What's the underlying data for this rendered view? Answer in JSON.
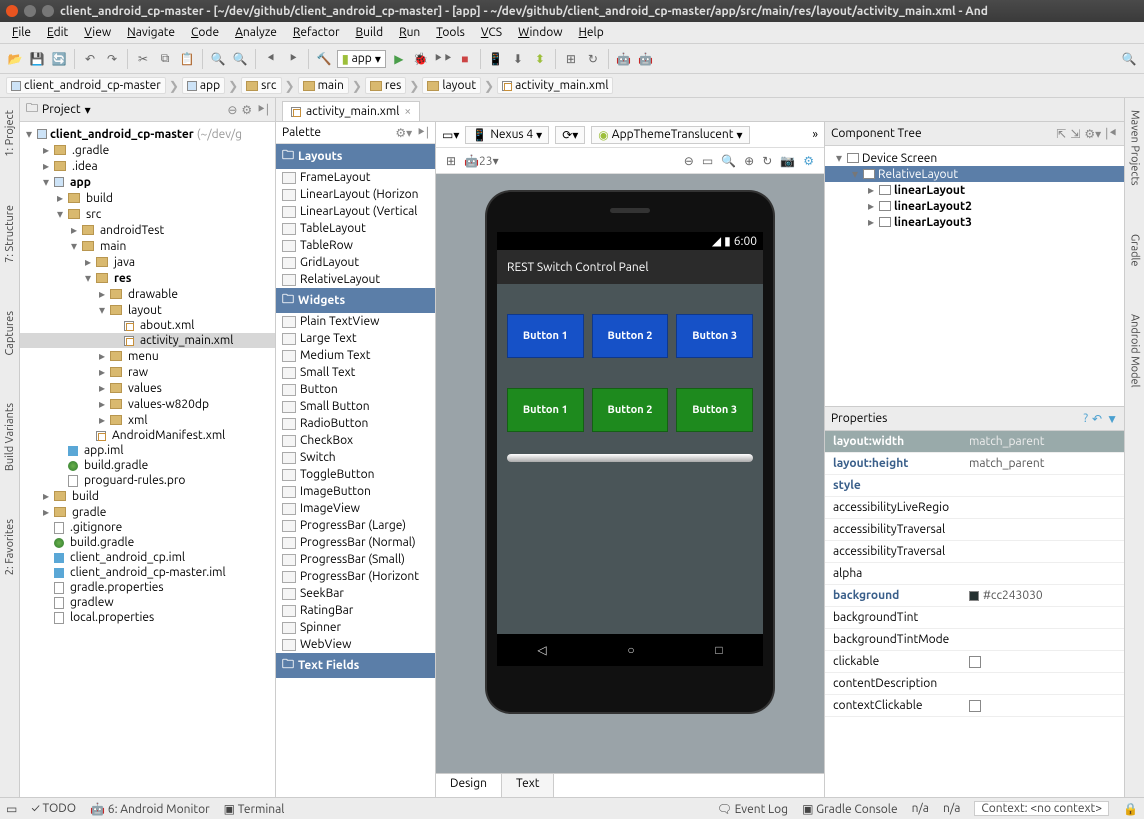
{
  "title": "client_android_cp-master - [~/dev/github/client_android_cp-master] - [app] - ~/dev/github/client_android_cp-master/app/src/main/res/layout/activity_main.xml - And",
  "menu": [
    "File",
    "Edit",
    "View",
    "Navigate",
    "Code",
    "Analyze",
    "Refactor",
    "Build",
    "Run",
    "Tools",
    "VCS",
    "Window",
    "Help"
  ],
  "toolbar_app": "app",
  "breadcrumb": [
    "client_android_cp-master",
    "app",
    "src",
    "main",
    "res",
    "layout",
    "activity_main.xml"
  ],
  "project_panel_label": "Project",
  "tree": {
    "root": "client_android_cp-master",
    "root_suffix": "(~/dev/g",
    "nodes": [
      {
        "d": 1,
        "exp": "▸",
        "icon": "dir",
        "t": ".gradle"
      },
      {
        "d": 1,
        "exp": "▸",
        "icon": "dir",
        "t": ".idea"
      },
      {
        "d": 1,
        "exp": "▾",
        "icon": "mod",
        "t": "app",
        "b": true
      },
      {
        "d": 2,
        "exp": "▸",
        "icon": "dir",
        "t": "build"
      },
      {
        "d": 2,
        "exp": "▾",
        "icon": "dir",
        "t": "src"
      },
      {
        "d": 3,
        "exp": "▸",
        "icon": "dir",
        "t": "androidTest"
      },
      {
        "d": 3,
        "exp": "▾",
        "icon": "dir",
        "t": "main"
      },
      {
        "d": 4,
        "exp": "▸",
        "icon": "dir",
        "t": "java"
      },
      {
        "d": 4,
        "exp": "▾",
        "icon": "dir",
        "t": "res",
        "b": true
      },
      {
        "d": 5,
        "exp": "▸",
        "icon": "dir",
        "t": "drawable"
      },
      {
        "d": 5,
        "exp": "▾",
        "icon": "dir",
        "t": "layout"
      },
      {
        "d": 6,
        "exp": "",
        "icon": "xml",
        "t": "about.xml"
      },
      {
        "d": 6,
        "exp": "",
        "icon": "xml",
        "t": "activity_main.xml",
        "sel": true
      },
      {
        "d": 5,
        "exp": "▸",
        "icon": "dir",
        "t": "menu"
      },
      {
        "d": 5,
        "exp": "▸",
        "icon": "dir",
        "t": "raw"
      },
      {
        "d": 5,
        "exp": "▸",
        "icon": "dir",
        "t": "values"
      },
      {
        "d": 5,
        "exp": "▸",
        "icon": "dir",
        "t": "values-w820dp"
      },
      {
        "d": 5,
        "exp": "▸",
        "icon": "dir",
        "t": "xml"
      },
      {
        "d": 4,
        "exp": "",
        "icon": "xml",
        "t": "AndroidManifest.xml"
      },
      {
        "d": 2,
        "exp": "",
        "icon": "iml",
        "t": "app.iml"
      },
      {
        "d": 2,
        "exp": "",
        "icon": "grad",
        "t": "build.gradle"
      },
      {
        "d": 2,
        "exp": "",
        "icon": "file",
        "t": "proguard-rules.pro"
      },
      {
        "d": 1,
        "exp": "▸",
        "icon": "dir",
        "t": "build"
      },
      {
        "d": 1,
        "exp": "▸",
        "icon": "dir",
        "t": "gradle"
      },
      {
        "d": 1,
        "exp": "",
        "icon": "file",
        "t": ".gitignore"
      },
      {
        "d": 1,
        "exp": "",
        "icon": "grad",
        "t": "build.gradle"
      },
      {
        "d": 1,
        "exp": "",
        "icon": "iml",
        "t": "client_android_cp.iml"
      },
      {
        "d": 1,
        "exp": "",
        "icon": "iml",
        "t": "client_android_cp-master.iml"
      },
      {
        "d": 1,
        "exp": "",
        "icon": "file",
        "t": "gradle.properties"
      },
      {
        "d": 1,
        "exp": "",
        "icon": "file",
        "t": "gradlew"
      },
      {
        "d": 1,
        "exp": "",
        "icon": "file",
        "t": "local.properties"
      }
    ]
  },
  "editor_tab": "activity_main.xml",
  "palette": {
    "title": "Palette",
    "groups": [
      {
        "name": "Layouts",
        "items": [
          "FrameLayout",
          "LinearLayout (Horizon",
          "LinearLayout (Vertical",
          "TableLayout",
          "TableRow",
          "GridLayout",
          "RelativeLayout"
        ]
      },
      {
        "name": "Widgets",
        "items": [
          "Plain TextView",
          "Large Text",
          "Medium Text",
          "Small Text",
          "Button",
          "Small Button",
          "RadioButton",
          "CheckBox",
          "Switch",
          "ToggleButton",
          "ImageButton",
          "ImageView",
          "ProgressBar (Large)",
          "ProgressBar (Normal)",
          "ProgressBar (Small)",
          "ProgressBar (Horizont",
          "SeekBar",
          "RatingBar",
          "Spinner",
          "WebView"
        ]
      },
      {
        "name": "Text Fields",
        "items": []
      }
    ]
  },
  "canvas": {
    "device": "Nexus 4",
    "theme": "AppThemeTranslucent",
    "api": "23",
    "status_time": "6:00",
    "app_title": "REST Switch Control Panel",
    "row1": [
      "Button 1",
      "Button 2",
      "Button 3"
    ],
    "row2": [
      "Button 1",
      "Button 2",
      "Button 3"
    ],
    "bottom_tabs": [
      "Design",
      "Text"
    ]
  },
  "component_tree": {
    "title": "Component Tree",
    "nodes": [
      {
        "d": 0,
        "exp": "▾",
        "t": "Device Screen"
      },
      {
        "d": 1,
        "exp": "▾",
        "t": "RelativeLayout",
        "sel": true
      },
      {
        "d": 2,
        "exp": "▸",
        "t": "linearLayout",
        "b": true
      },
      {
        "d": 2,
        "exp": "▸",
        "t": "linearLayout2",
        "b": true
      },
      {
        "d": 2,
        "exp": "▸",
        "t": "linearLayout3",
        "b": true
      }
    ]
  },
  "properties": {
    "title": "Properties",
    "rows": [
      {
        "k": "layout:width",
        "v": "match_parent",
        "sel": true,
        "b": true
      },
      {
        "k": "layout:height",
        "v": "match_parent",
        "b": true
      },
      {
        "k": "style",
        "v": "",
        "b": true
      },
      {
        "k": "accessibilityLiveRegio",
        "v": ""
      },
      {
        "k": "accessibilityTraversal",
        "v": ""
      },
      {
        "k": "accessibilityTraversal",
        "v": ""
      },
      {
        "k": "alpha",
        "v": ""
      },
      {
        "k": "background",
        "v": "#cc243030",
        "b": true,
        "swatch": true
      },
      {
        "k": "backgroundTint",
        "v": ""
      },
      {
        "k": "backgroundTintMode",
        "v": ""
      },
      {
        "k": "clickable",
        "v": "",
        "chk": true
      },
      {
        "k": "contentDescription",
        "v": ""
      },
      {
        "k": "contextClickable",
        "v": "",
        "chk": true
      }
    ]
  },
  "sidetabs_left": [
    "1: Project",
    "7: Structure",
    "Captures",
    "Build Variants",
    "2: Favorites"
  ],
  "sidetabs_right": [
    "Maven Projects",
    "Gradle",
    "Android Model"
  ],
  "statusbar": {
    "todo": "TODO",
    "android_mon": "6: Android Monitor",
    "terminal": "Terminal",
    "eventlog": "Event Log",
    "gradle_console": "Gradle Console",
    "na1": "n/a",
    "na2": "n/a",
    "context": "Context: <no context>"
  }
}
